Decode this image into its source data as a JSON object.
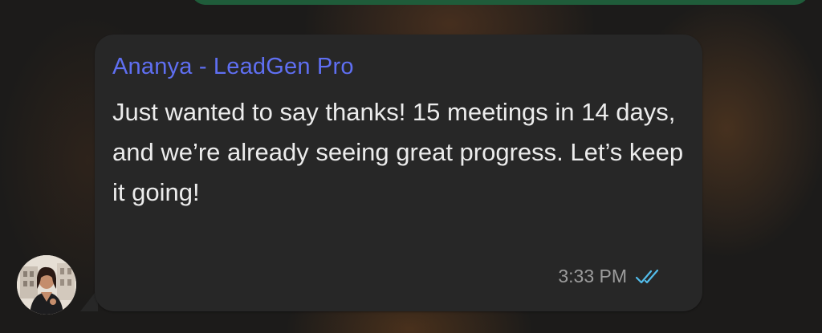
{
  "message": {
    "sender": "Ananya - LeadGen Pro",
    "text": "Just wanted to say thanks! 15 meetings in 14 days, and we’re already seeing great progress. Let’s keep it going!",
    "time": "3:33 PM",
    "status_icon": "double-check-icon"
  },
  "avatar": {
    "icon": "avatar"
  },
  "colors": {
    "sender_name": "#5f6ff2",
    "bubble": "#272727",
    "read_receipt": "#53bdeb",
    "outgoing_bubble": "#1f5c3a"
  }
}
